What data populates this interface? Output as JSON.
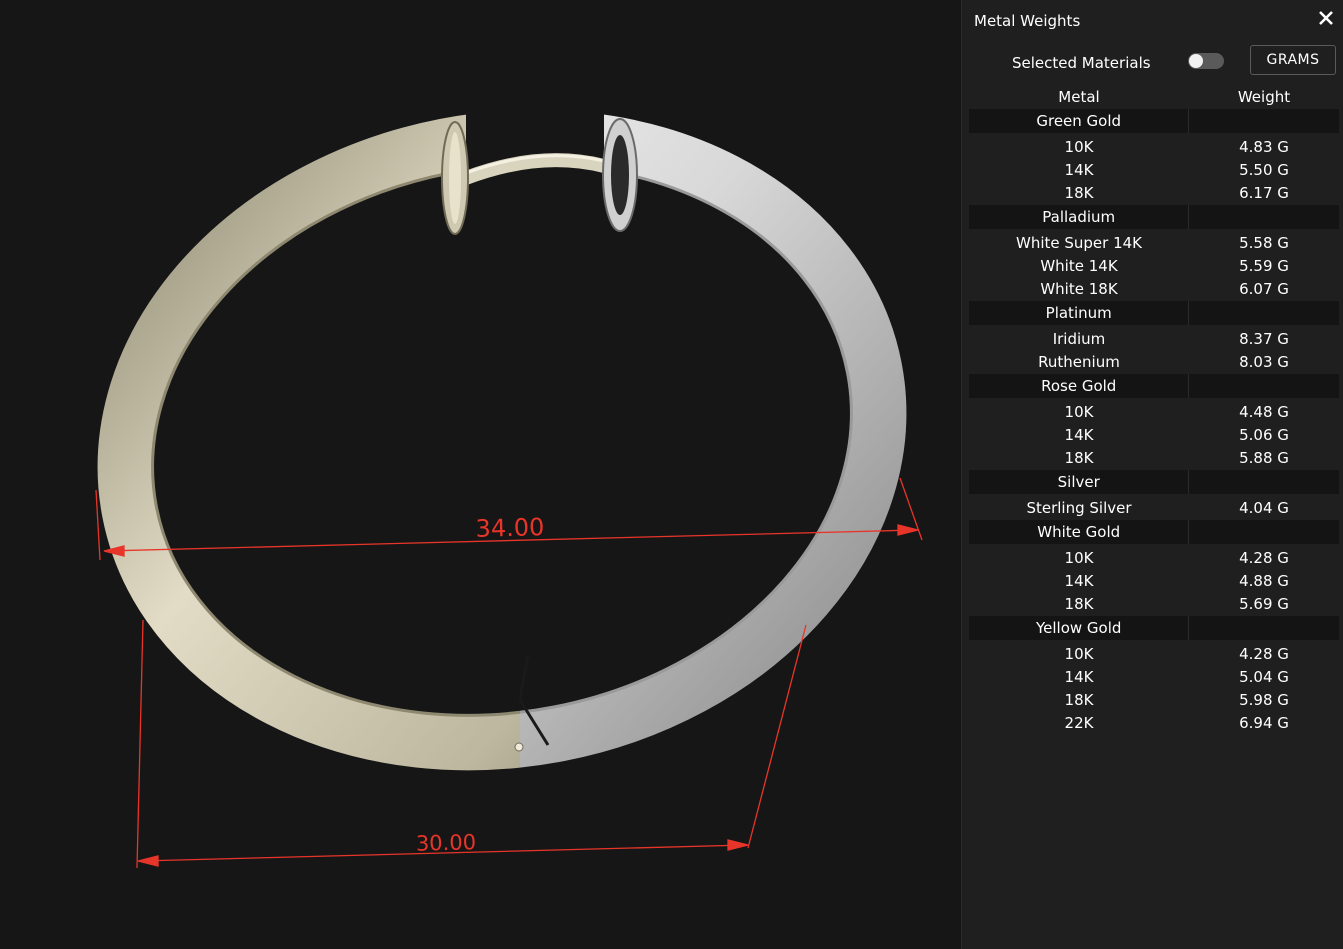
{
  "viewport": {
    "dimensions": {
      "outer_diameter": "34.00",
      "inner_diameter": "30.00"
    },
    "colors": {
      "dimension_line": "#e8352a",
      "metal_left": "#cfc9b2",
      "metal_right": "#e8e8e8",
      "background": "#161616"
    }
  },
  "panel": {
    "title": "Metal Weights",
    "close_icon": "close-icon",
    "selected_materials_label": "Selected Materials",
    "toggle_on": false,
    "units_label": "GRAMS",
    "columns": [
      "Metal",
      "Weight"
    ],
    "groups": [
      {
        "name": "Green Gold",
        "items": [
          {
            "metal": "10K",
            "weight": "4.83 G"
          },
          {
            "metal": "14K",
            "weight": "5.50 G"
          },
          {
            "metal": "18K",
            "weight": "6.17 G"
          }
        ]
      },
      {
        "name": "Palladium",
        "items": [
          {
            "metal": "White Super 14K",
            "weight": "5.58 G"
          },
          {
            "metal": "White 14K",
            "weight": "5.59 G"
          },
          {
            "metal": "White 18K",
            "weight": "6.07 G"
          }
        ]
      },
      {
        "name": "Platinum",
        "items": [
          {
            "metal": "Iridium",
            "weight": "8.37 G"
          },
          {
            "metal": "Ruthenium",
            "weight": "8.03 G"
          }
        ]
      },
      {
        "name": "Rose Gold",
        "items": [
          {
            "metal": "10K",
            "weight": "4.48 G"
          },
          {
            "metal": "14K",
            "weight": "5.06 G"
          },
          {
            "metal": "18K",
            "weight": "5.88 G"
          }
        ]
      },
      {
        "name": "Silver",
        "items": [
          {
            "metal": "Sterling Silver",
            "weight": "4.04 G"
          }
        ]
      },
      {
        "name": "White Gold",
        "items": [
          {
            "metal": "10K",
            "weight": "4.28 G"
          },
          {
            "metal": "14K",
            "weight": "4.88 G"
          },
          {
            "metal": "18K",
            "weight": "5.69 G"
          }
        ]
      },
      {
        "name": "Yellow Gold",
        "items": [
          {
            "metal": "10K",
            "weight": "4.28 G"
          },
          {
            "metal": "14K",
            "weight": "5.04 G"
          },
          {
            "metal": "18K",
            "weight": "5.98 G"
          },
          {
            "metal": "22K",
            "weight": "6.94 G"
          }
        ]
      }
    ]
  }
}
